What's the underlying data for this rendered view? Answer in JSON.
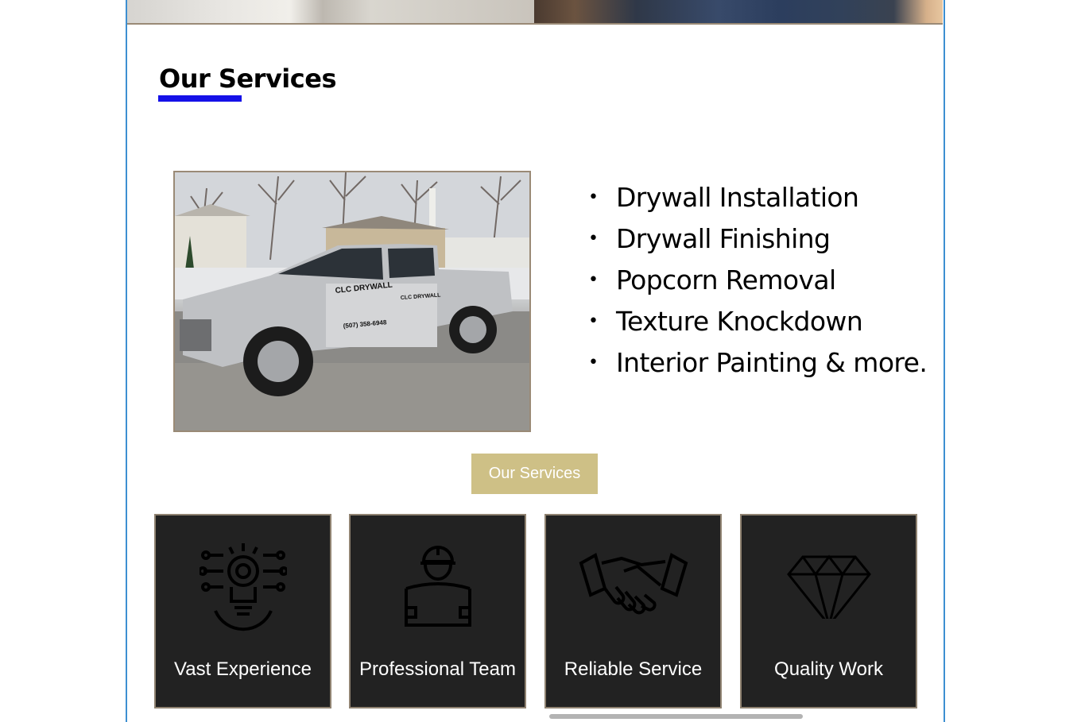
{
  "section": {
    "title": "Our Services"
  },
  "services_list": [
    "Drywall Installation",
    "Drywall Finishing",
    "Popcorn Removal",
    "Texture Knockdown",
    "Interior Painting & more."
  ],
  "truck_photo": {
    "door_logo_text": "CLC DRYWALL",
    "phone_text": "(507) 358-6948",
    "rear_door_text": "CLC DRYWALL"
  },
  "services_button": {
    "label": "Our Services"
  },
  "feature_cards": [
    {
      "label": "Vast Experience",
      "icon": "gear-lightbulb-icon"
    },
    {
      "label": "Professional Team",
      "icon": "worker-blueprint-icon"
    },
    {
      "label": "Reliable Service",
      "icon": "handshake-icon"
    },
    {
      "label": "Quality Work",
      "icon": "diamond-icon"
    }
  ],
  "colors": {
    "title_underline": "#1511e8",
    "button_bg": "#cec086",
    "card_bg": "#222222",
    "card_border": "#8f8271",
    "frame_border": "#3d8fd1"
  }
}
